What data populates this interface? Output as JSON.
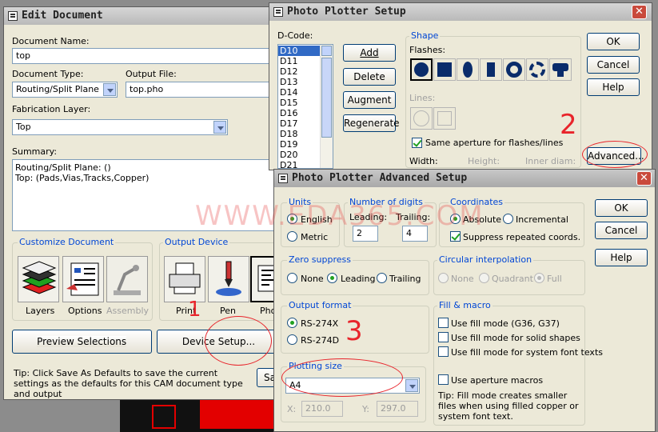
{
  "watermark": "WWW.EDA365.COM",
  "edit_doc": {
    "title": "Edit Document",
    "doc_name_label": "Document Name:",
    "doc_name_value": "top",
    "doc_type_label": "Document Type:",
    "doc_type_value": "Routing/Split Plane",
    "output_file_label": "Output File:",
    "output_file_value": "top.pho",
    "fab_layer_label": "Fabrication Layer:",
    "fab_layer_value": "Top",
    "summary_label": "Summary:",
    "summary_line1": "Routing/Split Plane: ()",
    "summary_line2": "Top: (Pads,Vias,Tracks,Copper)",
    "customize_title": "Customize Document",
    "layers_label": "Layers",
    "options_label": "Options",
    "assembly_label": "Assembly",
    "output_device_title": "Output Device",
    "print_label": "Print",
    "pen_label": "Pen",
    "photo_label": "Pho",
    "preview_btn": "Preview Selections",
    "device_setup_btn": "Device Setup...",
    "save_btn": "Sa",
    "tip": "Tip: Click Save As Defaults to save the current settings as the defaults for this CAM document type and output"
  },
  "photo_setup": {
    "title": "Photo Plotter Setup",
    "dcode_label": "D-Code:",
    "dcodes": [
      "D10",
      "D11",
      "D12",
      "D13",
      "D14",
      "D15",
      "D16",
      "D17",
      "D18",
      "D19",
      "D20",
      "D21"
    ],
    "add_btn": "Add",
    "delete_btn": "Delete",
    "augment_btn": "Augment",
    "regenerate_btn": "Regenerate",
    "shape_title": "Shape",
    "flashes_label": "Flashes:",
    "lines_label": "Lines:",
    "same_aperture_label": "Same aperture for flashes/lines",
    "width_label": "Width:",
    "height_label": "Height:",
    "inner_diam_label": "Inner diam:",
    "ok_btn": "OK",
    "cancel_btn": "Cancel",
    "help_btn": "Help",
    "advanced_btn": "Advanced..."
  },
  "advanced": {
    "title": "Photo Plotter Advanced Setup",
    "units_title": "Units",
    "english": "English",
    "metric": "Metric",
    "digits_title": "Number of digits",
    "leading_label": "Leading:",
    "leading_value": "2",
    "trailing_label": "Trailing:",
    "trailing_value": "4",
    "coords_title": "Coordinates",
    "absolute": "Absolute",
    "incremental": "Incremental",
    "suppress_coords": "Suppress repeated coords.",
    "zero_title": "Zero suppress",
    "none": "None",
    "leading": "Leading",
    "trailing": "Trailing",
    "circ_title": "Circular interpolation",
    "circ_none": "None",
    "quadrant": "Quadrant",
    "full": "Full",
    "format_title": "Output format",
    "rs274x": "RS-274X",
    "rs274d": "RS-274D",
    "fill_title": "Fill & macro",
    "fill1": "Use fill mode (G36, G37)",
    "fill2": "Use fill mode for solid shapes",
    "fill3": "Use fill mode for system font texts",
    "macros": "Use aperture macros",
    "fill_tip": "Tip: Fill mode creates smaller files when using filled copper or system font text.",
    "size_title": "Plotting size",
    "size_value": "A4",
    "x_label": "X:",
    "x_value": "210.0",
    "y_label": "Y:",
    "y_value": "297.0",
    "ok_btn": "OK",
    "cancel_btn": "Cancel",
    "help_btn": "Help"
  },
  "annotations": {
    "n1": "1",
    "n2": "2",
    "n3": "3"
  },
  "colors": {
    "accent_red": "#e8242b",
    "selection_blue": "#316ac5",
    "xp_border": "#003c74"
  }
}
